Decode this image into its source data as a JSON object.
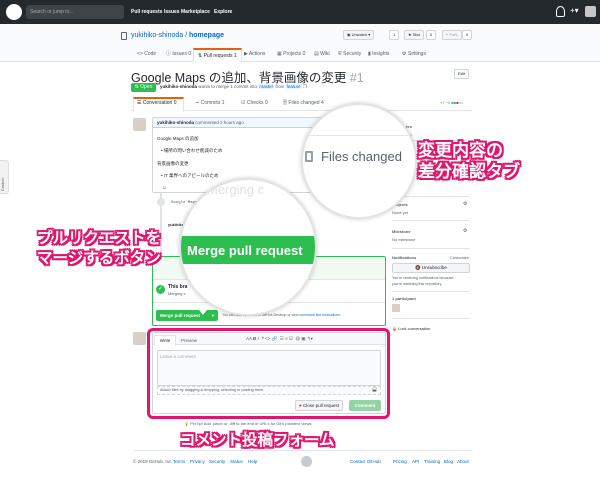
{
  "topnav": {
    "search_placeholder": "Search or jump to...",
    "links": [
      "Pull requests",
      "Issues",
      "Marketplace",
      "Explore"
    ]
  },
  "repo": {
    "owner": "yukihiko-shinoda",
    "separator": " / ",
    "name": "homepage",
    "actions": [
      {
        "label": "Unwatch ▾",
        "count": "1"
      },
      {
        "label": "Star",
        "count": "0"
      },
      {
        "label": "Fork",
        "count": "0"
      }
    ],
    "tabs": [
      {
        "label": "Code",
        "count": ""
      },
      {
        "label": "Issues",
        "count": "0"
      },
      {
        "label": "Pull requests",
        "count": "1"
      },
      {
        "label": "Actions",
        "count": ""
      },
      {
        "label": "Projects",
        "count": "0"
      },
      {
        "label": "Wiki",
        "count": ""
      },
      {
        "label": "Security",
        "count": ""
      },
      {
        "label": "Insights",
        "count": ""
      },
      {
        "label": "Settings",
        "count": ""
      }
    ]
  },
  "pr": {
    "title": "Google Maps の追加、背景画像の変更",
    "number": "#1",
    "edit_label": "Edit",
    "status": "Open",
    "meta": {
      "author": "yukihiko-shinoda",
      "text1": "wants to merge 1 commit into",
      "base": "master",
      "text2": "from",
      "head": "feature"
    },
    "tabs": [
      {
        "label": "Conversation",
        "count": "0"
      },
      {
        "label": "Commits",
        "count": "1"
      },
      {
        "label": "Checks",
        "count": "0"
      },
      {
        "label": "Files changed",
        "count": "4"
      }
    ],
    "diffstat": "+7 −2"
  },
  "comment": {
    "author": "yukihiko-shinoda",
    "time": "commented 2 hours ago",
    "heading1": "Google Maps の追加",
    "item1": "場所の問い合わせ削減のため",
    "heading2": "背景画像の変更",
    "item2": "IT 業界へのアピールのため"
  },
  "commit_row": {
    "text": "Google Maps の追加、背景画像の変更"
  },
  "commit_row2": {
    "author": "yukihiko-shinoda"
  },
  "merge": {
    "faded": "Merging c",
    "branch_title": "This bra",
    "branch_sub": "Merging c",
    "button": "Merge pull request",
    "hint_prefix": "You can also open this in GitHub Desktop or view",
    "hint_link": "command line instructions."
  },
  "zoom_files": {
    "label": "Files changed"
  },
  "zoom_merge": {
    "faded": "Merging c",
    "button": "Merge pull request",
    "branch": "This bra",
    "sub": "Merging"
  },
  "editor": {
    "tab_write": "Write",
    "tab_preview": "Preview",
    "toolbar_aa": "AA",
    "placeholder": "Leave a comment",
    "attach_text": "Attach files by dragging & dropping, selecting or pasting them.",
    "close_button": "Close pull request",
    "comment_button": "Comment",
    "protip": "ProTip! Add .patch or .diff to the end of URLs for Git's plaintext views."
  },
  "sidebar": {
    "reviewers_h": "Reviewers",
    "reviewers_v": "No reviews",
    "assignees_h": "Assignees",
    "assignees_v": "No one—",
    "labels_h": "Labels",
    "labels_v": "None yet",
    "projects_h": "Projects",
    "projects_v": "None yet",
    "milestone_h": "Milestone",
    "milestone_v": "No milestone",
    "notifications_h": "Notifications",
    "customize": "Customize",
    "unsubscribe": "Unsubscribe",
    "notif_text1": "You're receiving notifications because",
    "notif_text2": "you're watching this repository.",
    "participants_h": "1 participant",
    "lock": "Lock conversation"
  },
  "callouts": {
    "files_line1": "変更内容の",
    "files_line2": "差分確認タブ",
    "merge_line1": "プルリクエストを",
    "merge_line2": "マージするボタン",
    "form": "コメント投稿フォーム"
  },
  "side_tab": "Octotree",
  "footer": {
    "copyright": "© 2019 GitHub, Inc.",
    "left": [
      "Terms",
      "Privacy",
      "Security",
      "Status",
      "Help"
    ],
    "right": [
      "Contact GitHub",
      "Pricing",
      "API",
      "Training",
      "Blog",
      "About"
    ]
  },
  "colors": {
    "accent": "#e0166c",
    "green": "#2cbe4e",
    "header": "#24292e",
    "link": "#0366d6"
  }
}
